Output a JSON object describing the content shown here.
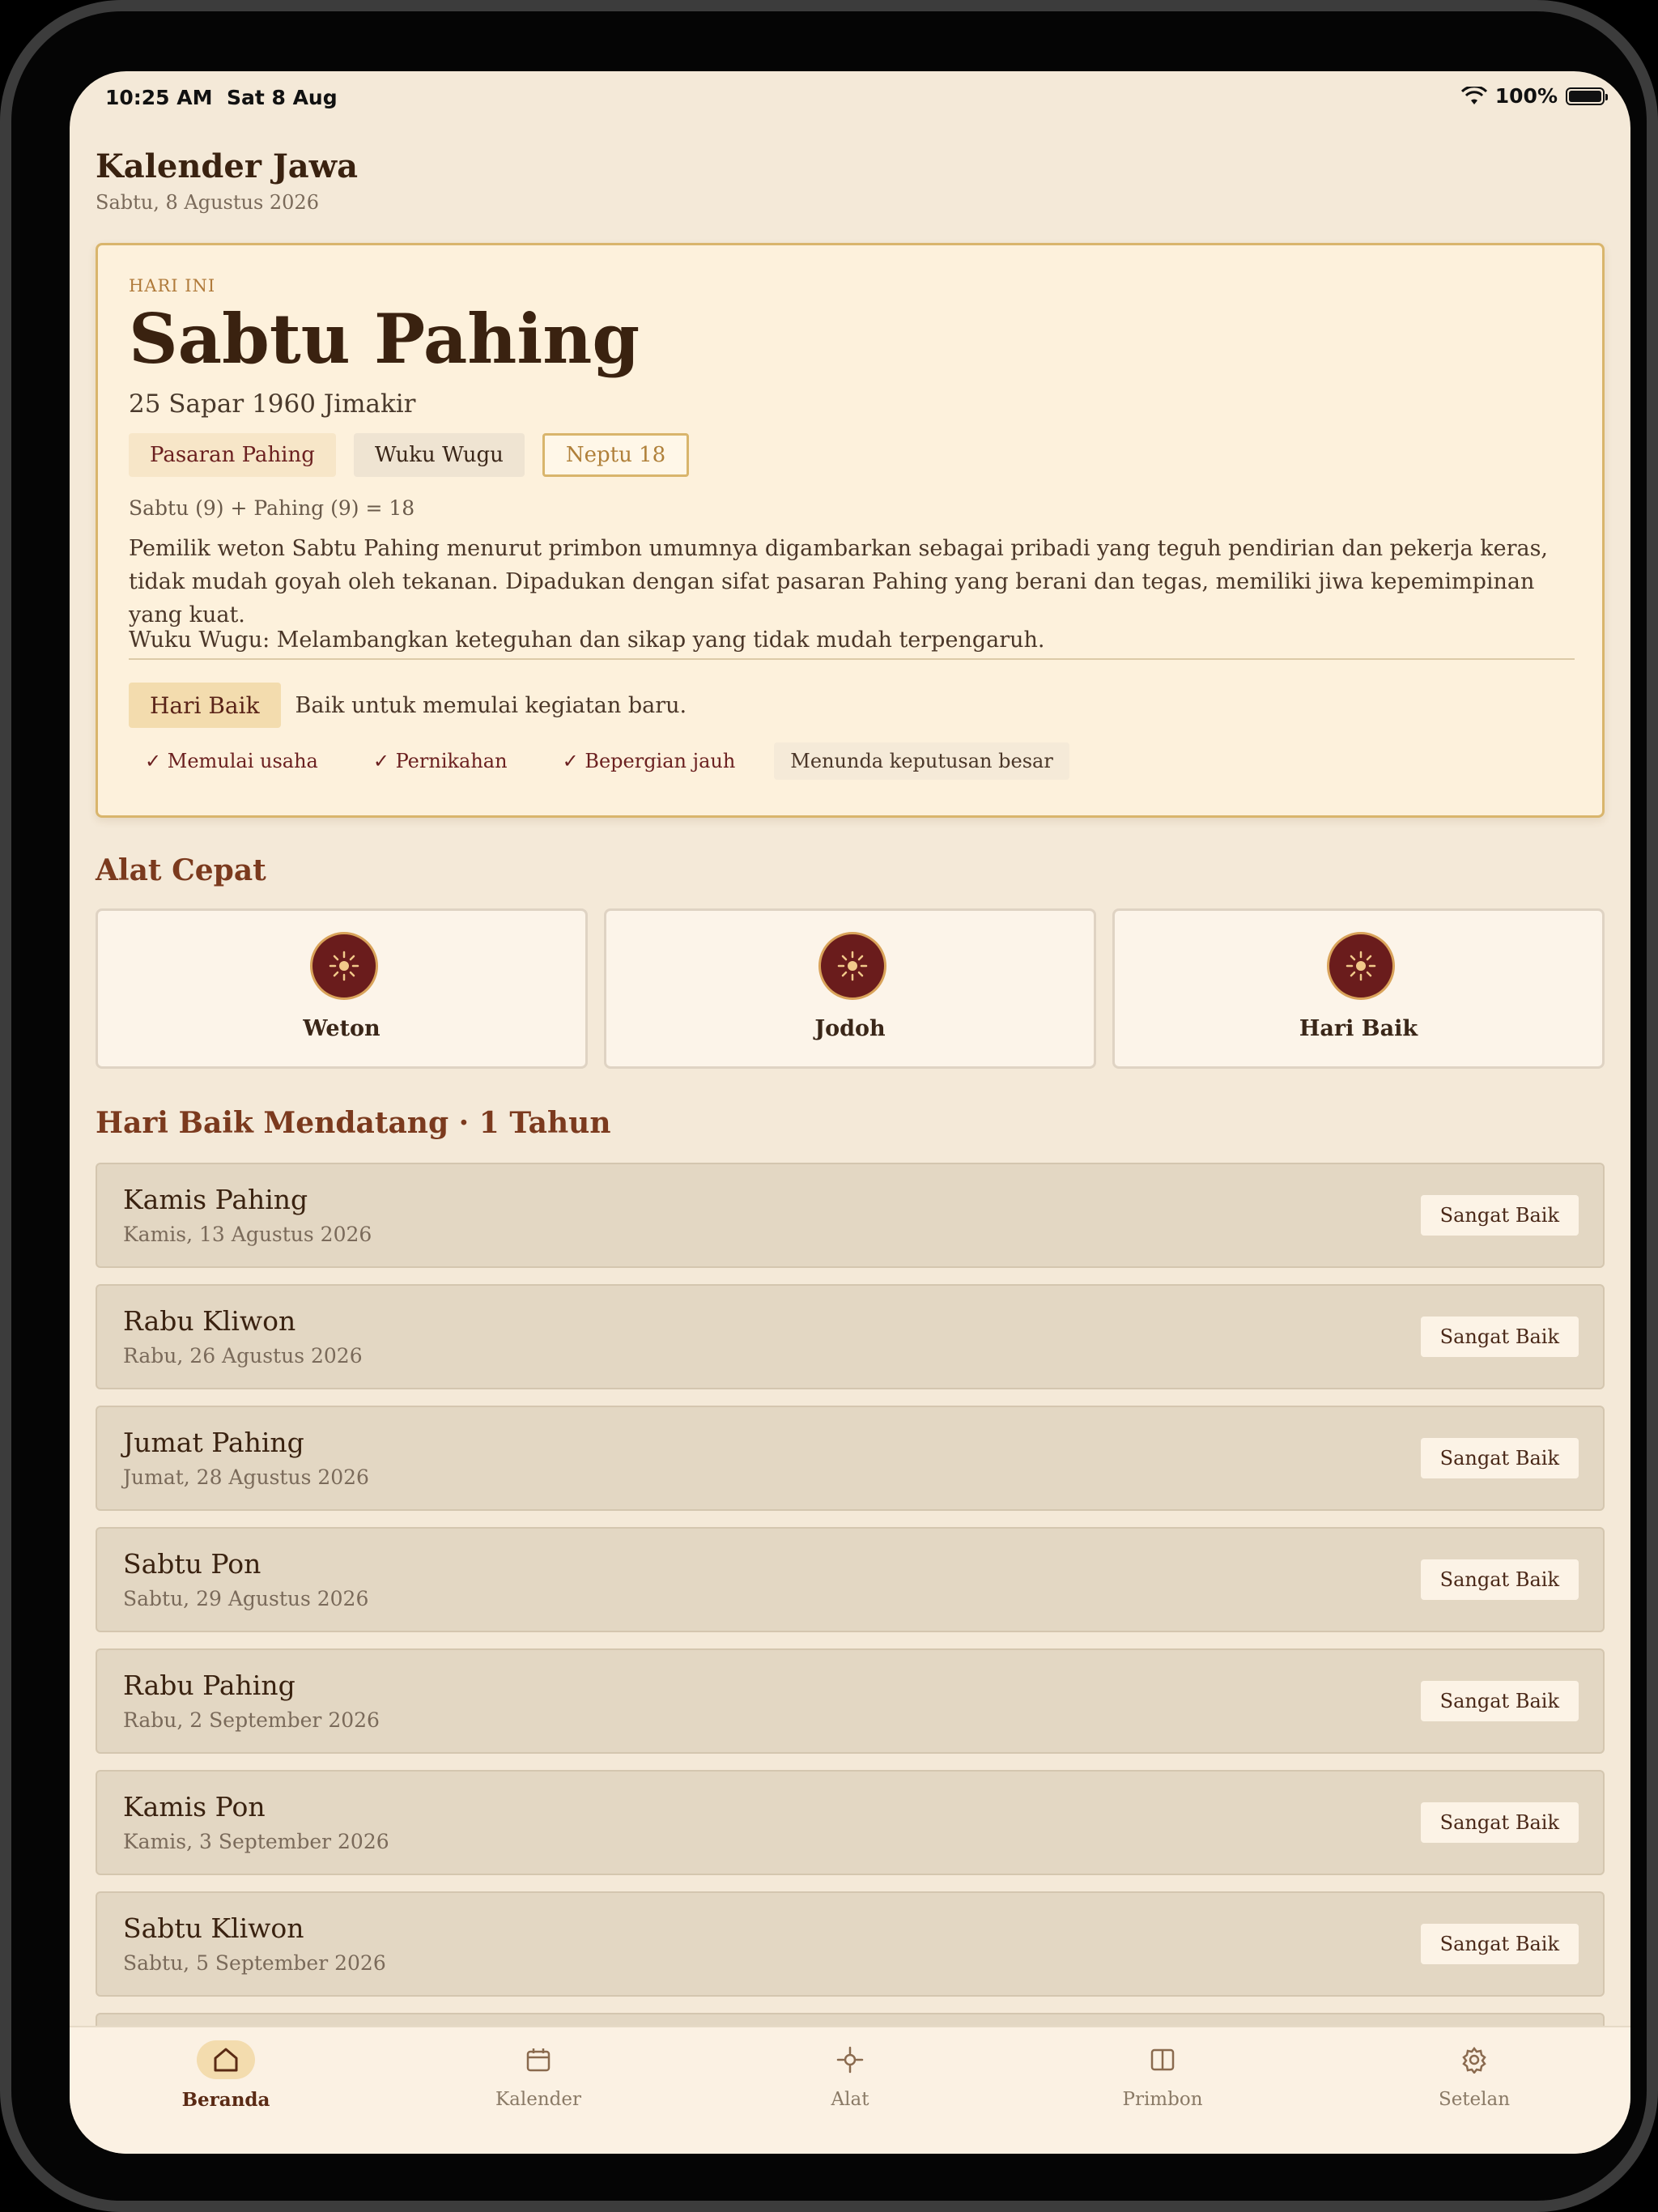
{
  "status_bar": {
    "time": "10:25 AM",
    "date": "Sat 8 Aug",
    "battery": "100%"
  },
  "header": {
    "title": "Kalender Jawa",
    "date": "Sabtu, 8 Agustus 2026"
  },
  "today": {
    "label": "HARI INI",
    "title": "Sabtu Pahing",
    "javanese_date": "25 Sapar 1960 Jimakir",
    "chip_pasaran": "Pasaran Pahing",
    "chip_wuku": "Wuku Wugu",
    "chip_neptu": "Neptu 18",
    "neptu_formula": "Sabtu (9) + Pahing (9) = 18",
    "description": "Pemilik weton Sabtu Pahing menurut primbon umumnya digambarkan sebagai pribadi yang teguh pendirian dan pekerja keras, tidak mudah goyah oleh tekanan. Dipadukan dengan sifat pasaran Pahing yang berani dan tegas, memiliki jiwa kepemimpinan yang kuat.",
    "wuku_description": "Wuku Wugu: Melambangkan keteguhan dan sikap yang tidak mudah terpengaruh.",
    "badge": "Hari Baik",
    "badge_text": "Baik untuk memulai kegiatan baru.",
    "tags": [
      "✓ Memulai usaha",
      "✓ Pernikahan",
      "✓ Bepergian jauh",
      "Menunda keputusan besar"
    ]
  },
  "quick_tools": {
    "title": "Alat Cepat",
    "items": [
      {
        "label": "Weton",
        "icon": "sun-icon"
      },
      {
        "label": "Jodoh",
        "icon": "sun-icon"
      },
      {
        "label": "Hari Baik",
        "icon": "sun-icon"
      }
    ]
  },
  "upcoming": {
    "title": "Hari Baik Mendatang · 1 Tahun",
    "items": [
      {
        "name": "Kamis Pahing",
        "date": "Kamis, 13 Agustus 2026",
        "badge": "Sangat Baik"
      },
      {
        "name": "Rabu Kliwon",
        "date": "Rabu, 26 Agustus 2026",
        "badge": "Sangat Baik"
      },
      {
        "name": "Jumat Pahing",
        "date": "Jumat, 28 Agustus 2026",
        "badge": "Sangat Baik"
      },
      {
        "name": "Sabtu Pon",
        "date": "Sabtu, 29 Agustus 2026",
        "badge": "Sangat Baik"
      },
      {
        "name": "Rabu Pahing",
        "date": "Rabu, 2 September 2026",
        "badge": "Sangat Baik"
      },
      {
        "name": "Kamis Pon",
        "date": "Kamis, 3 September 2026",
        "badge": "Sangat Baik"
      },
      {
        "name": "Sabtu Kliwon",
        "date": "Sabtu, 5 September 2026",
        "badge": "Sangat Baik"
      }
    ]
  },
  "tabbar": {
    "items": [
      {
        "label": "Beranda",
        "icon": "home-icon",
        "active": true
      },
      {
        "label": "Kalender",
        "icon": "calendar-icon",
        "active": false
      },
      {
        "label": "Alat",
        "icon": "compass-icon",
        "active": false
      },
      {
        "label": "Primbon",
        "icon": "book-icon",
        "active": false
      },
      {
        "label": "Setelan",
        "icon": "gear-icon",
        "active": false
      }
    ]
  },
  "colors": {
    "accent": "#6a1c1c",
    "gold": "#d9b56c",
    "background": "#f4e9d8"
  }
}
